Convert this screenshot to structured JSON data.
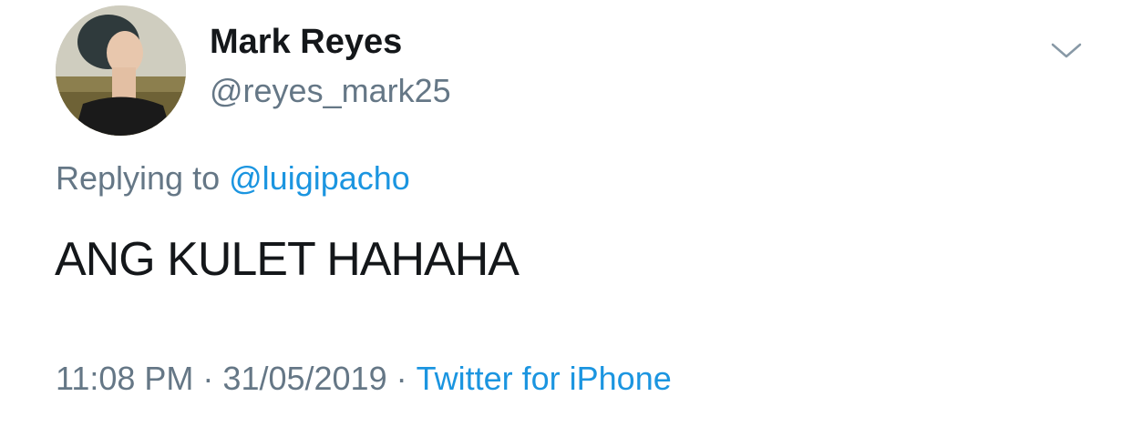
{
  "tweet": {
    "author": {
      "display_name": "Mark Reyes",
      "handle": "@reyes_mark25",
      "avatar": "user-avatar-photo"
    },
    "menu_icon": "chevron-down-icon",
    "reply": {
      "prefix": "Replying to",
      "mention": "@luigipacho"
    },
    "text": "ANG KULET HAHAHA",
    "meta": {
      "time": "11:08 PM",
      "separator": "·",
      "date": "31/05/2019",
      "source": "Twitter for iPhone"
    },
    "colors": {
      "text": "#14171a",
      "secondary": "#657786",
      "link": "#1b95e0"
    }
  }
}
